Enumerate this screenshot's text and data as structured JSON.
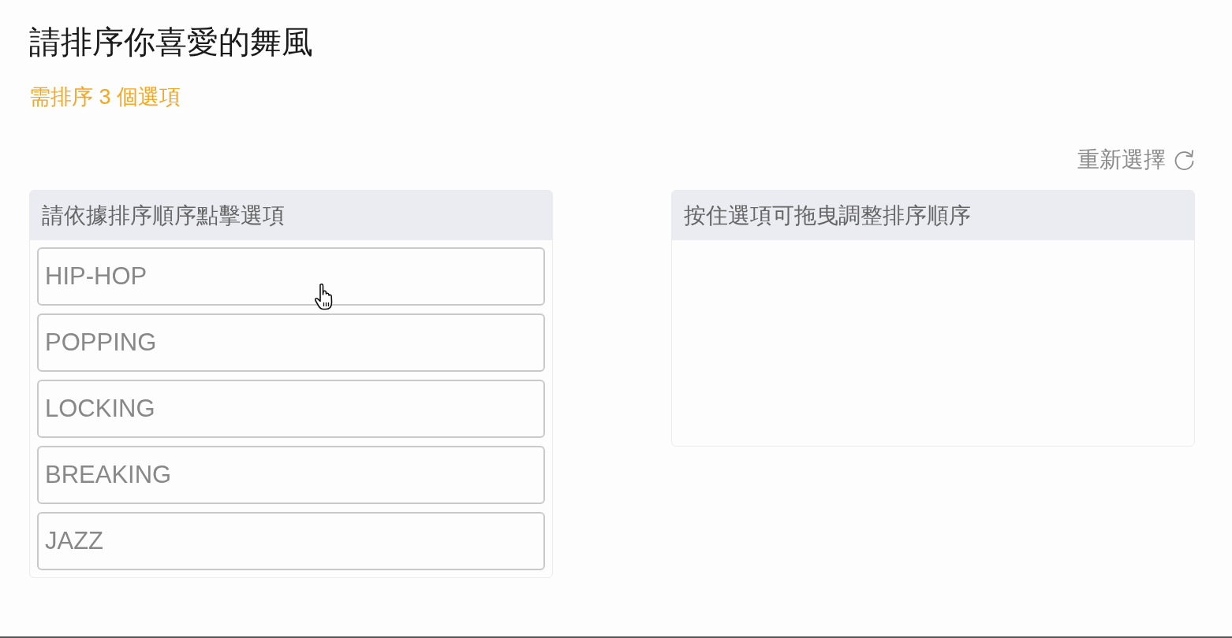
{
  "title": "請排序你喜愛的舞風",
  "requirement": "需排序 3 個選項",
  "reset_button": {
    "label": "重新選擇"
  },
  "options_panel": {
    "header": "請依據排序順序點擊選項",
    "options": [
      {
        "label": "HIP-HOP"
      },
      {
        "label": "POPPING"
      },
      {
        "label": "LOCKING"
      },
      {
        "label": "BREAKING"
      },
      {
        "label": "JAZZ"
      }
    ]
  },
  "ranking_panel": {
    "header": "按住選項可拖曳調整排序順序"
  }
}
